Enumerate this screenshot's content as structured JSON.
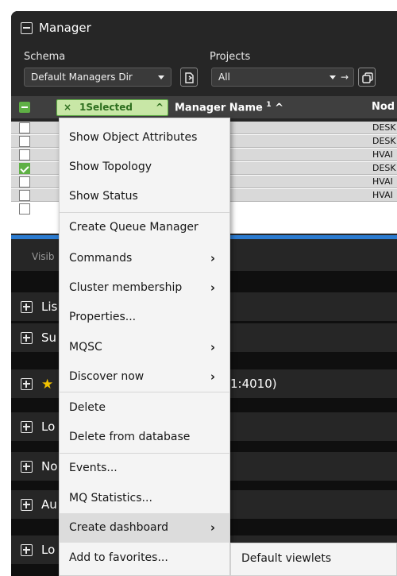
{
  "manager": {
    "title": "Manager",
    "schema_label": "Schema",
    "schema_value": "Default Managers Dir",
    "projects_label": "Projects",
    "projects_value": "All",
    "projects_arrow": "→",
    "selection_chip": "1Selected",
    "selection_clear": "×",
    "selection_collapse": "^",
    "columns": {
      "name": "Manager Name",
      "name_sort_index": "1",
      "name_sort_dir": "^",
      "node": "Nod"
    },
    "rows": [
      {
        "checked": false,
        "node": "DESK"
      },
      {
        "checked": false,
        "node": "DESK"
      },
      {
        "checked": false,
        "node": "HVAI"
      },
      {
        "checked": true,
        "node": "DESK"
      },
      {
        "checked": false,
        "node": "HVAI"
      },
      {
        "checked": false,
        "node": "HVAI"
      }
    ],
    "visible_text": "Visib"
  },
  "collapsed_panels": [
    {
      "text": "Lis"
    },
    {
      "text": "Su"
    },
    {
      "text": "1:4010)"
    },
    {
      "text": "Lo"
    },
    {
      "text": "No"
    },
    {
      "text": "Au"
    },
    {
      "text": "Lo"
    }
  ],
  "context_menu": [
    {
      "label": "Show Object Attributes",
      "submenu": false
    },
    {
      "label": "Show Topology",
      "submenu": false
    },
    {
      "label": "Show Status",
      "submenu": false
    },
    {
      "label": "Create Queue Manager",
      "submenu": false
    },
    {
      "label": "Commands",
      "submenu": true
    },
    {
      "label": "Cluster membership",
      "submenu": true
    },
    {
      "label": "Properties...",
      "submenu": false
    },
    {
      "label": "MQSC",
      "submenu": true
    },
    {
      "label": "Discover now",
      "submenu": true
    },
    {
      "label": "Delete",
      "submenu": false
    },
    {
      "label": "Delete from database",
      "submenu": false
    },
    {
      "label": "Events...",
      "submenu": false
    },
    {
      "label": "MQ Statistics...",
      "submenu": false
    },
    {
      "label": "Create dashboard",
      "submenu": true,
      "highlighted": true
    },
    {
      "label": "Add to favorites...",
      "submenu": false
    }
  ],
  "submenu_item": "Default viewlets",
  "icons": {
    "chevron": "›",
    "star": "★"
  },
  "colors": {
    "accent_green": "#5fb045",
    "chip_bg": "#c8e7a6",
    "scroll_blue": "#2b7bd0",
    "star": "#f2c200"
  }
}
